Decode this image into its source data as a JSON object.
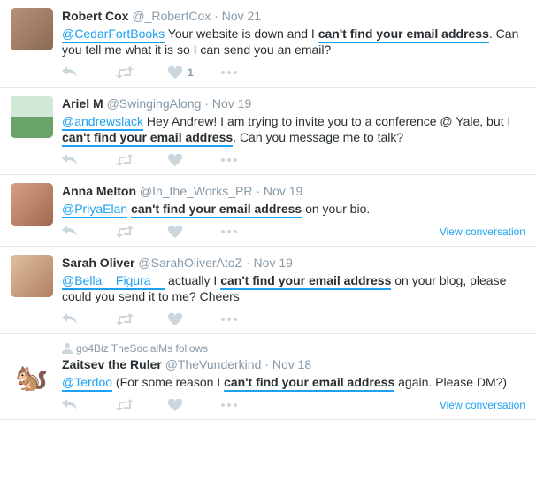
{
  "tweets": [
    {
      "name": "Robert Cox",
      "handle": "@_RobertCox",
      "date": "Nov 21",
      "mention": "@CedarFortBooks",
      "text_before": " Your website is down and I ",
      "highlight": "can't find your email address",
      "text_after": ". Can you tell me what it is so I can send you an email?",
      "like_count": "1",
      "view_conversation": "",
      "follows_label": ""
    },
    {
      "name": "Ariel M",
      "handle": "@SwingingAlong",
      "date": "Nov 19",
      "mention": "@andrewslack",
      "text_before": " Hey Andrew! I am trying to invite you to a conference @ Yale, but I ",
      "highlight": "can't find your email address",
      "text_after": ". Can you message me to talk?",
      "like_count": "",
      "view_conversation": "",
      "follows_label": ""
    },
    {
      "name": "Anna Melton",
      "handle": "@In_the_Works_PR",
      "date": "Nov 19",
      "mention": "@PriyaElan",
      "text_before": " ",
      "highlight": "can't find your email address",
      "text_after": " on your bio.",
      "like_count": "",
      "view_conversation": "View conversation",
      "follows_label": ""
    },
    {
      "name": "Sarah Oliver",
      "handle": "@SarahOliverAtoZ",
      "date": "Nov 19",
      "mention": "@Bella__Figura__",
      "text_before": " actually I ",
      "highlight": "can't find your email address",
      "text_after": " on your blog, please could you send it to me? Cheers",
      "like_count": "",
      "view_conversation": "",
      "follows_label": ""
    },
    {
      "name": "Zaitsev the Ruler",
      "handle": "@TheVunderkind",
      "date": "Nov 18",
      "mention": "@Terdoo",
      "text_before": " (For some reason I ",
      "highlight": "can't find your email address",
      "text_after": " again. Please DM?)",
      "like_count": "",
      "view_conversation": "View conversation",
      "follows_label": "go4Biz TheSocialMs follows"
    }
  ]
}
